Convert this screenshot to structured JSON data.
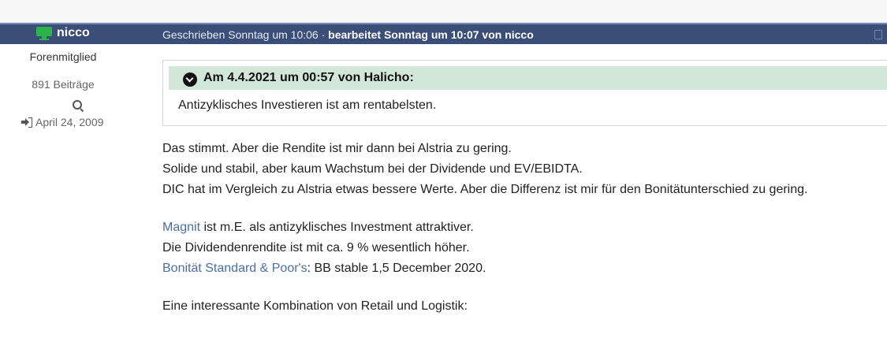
{
  "post": {
    "author": "nicco",
    "rank": "Forenmitglied",
    "posts_count": "891 Beiträge",
    "joined": "April 24, 2009",
    "meta_prefix": "Geschrieben Sonntag um 10:06 · ",
    "meta_edited": "bearbeitet Sonntag um 10:07 von nicco"
  },
  "quote": {
    "title": "Am 4.4.2021 um 00:57 von Halicho:",
    "text": "Antizyklisches Investieren ist am rentabelsten."
  },
  "content": {
    "p1_l1": "Das stimmt. Aber die Rendite ist mir dann bei Alstria zu gering.",
    "p1_l2": "Solide und stabil, aber kaum Wachstum bei der Dividende und EV/EBIDTA.",
    "p1_l3": "DIC hat im Vergleich zu Alstria etwas bessere Werte. Aber die Differenz ist mir für den Bonitätunterschied zu gering.",
    "link_magnit": "Magnit",
    "p2_l1_rest": " ist m.E. als antizyklisches Investment attraktiver.",
    "p2_l2": "Die Dividendenrendite ist mit ca. 9 % wesentlich höher.",
    "link_sp": "Bonität Standard & Poor's",
    "p2_l3_rest": ": BB stable 1,5 December 2020.",
    "p3": "Eine interessante Kombination von Retail und Logistik:"
  },
  "icons": {
    "user_status": "monitor-icon",
    "message": "envelope-icon",
    "search": "search-icon",
    "joined": "sign-in-icon",
    "quote_toggle": "chevron-down-circle-icon"
  },
  "colors": {
    "header_bg": "#3a4e78",
    "online": "#2bb34b",
    "quote_head_bg": "#d3e6da",
    "link": "#4a6ea9"
  }
}
